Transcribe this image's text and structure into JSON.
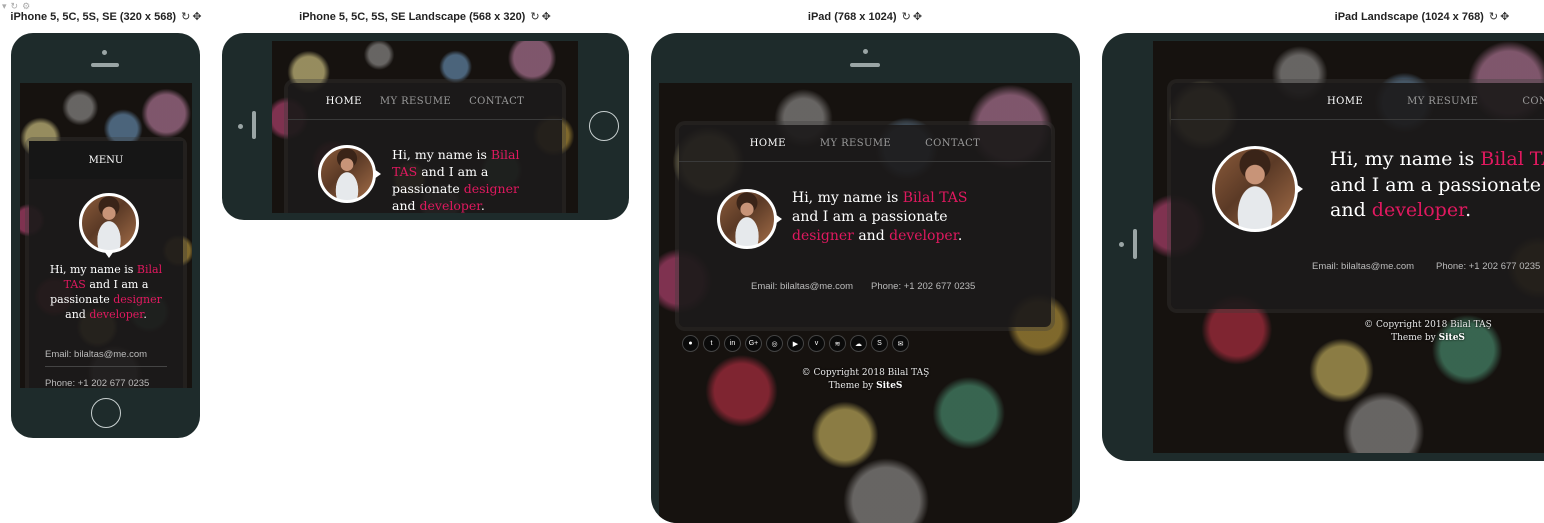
{
  "devices": {
    "iphone": {
      "label": "iPhone 5, 5C, 5S, SE (320 x 568)"
    },
    "iphone_land": {
      "label": "iPhone 5, 5C, 5S, SE Landscape (568 x 320)"
    },
    "ipad": {
      "label": "iPad (768 x 1024)"
    },
    "ipad_land": {
      "label": "iPad Landscape (1024 x 768)"
    }
  },
  "icons": {
    "rotate": "↻",
    "move": "✥"
  },
  "nav": {
    "home": "HOME",
    "resume": "MY RESUME",
    "contact": "CONTACT"
  },
  "menu_label": "MENU",
  "intro": {
    "prefix": "Hi, my name is ",
    "name": "Bilal TAS",
    "name_first": "Bilal",
    "name_last": "TAS",
    "mid": " and I am a passionate ",
    "mid_a": " and I am a",
    "mid_b": "passionate ",
    "mid_c": "and I am a passionate",
    "designer": "designer",
    "and": " and ",
    "developer": "developer",
    "end": "."
  },
  "contact": {
    "email": "Email: bilaltas@me.com",
    "phone": "Phone: +1 202 677 0235"
  },
  "footer": {
    "copyright": "© Copyright 2018 Bilal TAŞ",
    "theme_prefix": "Theme by ",
    "theme_name": "SiteS"
  },
  "social_icons": [
    "github-icon",
    "twitter-icon",
    "linkedin-icon",
    "google-plus-icon",
    "instagram-icon",
    "youtube-icon",
    "vimeo-icon",
    "spotify-icon",
    "soundcloud-icon",
    "skype-icon",
    "email-icon"
  ],
  "social_glyphs": [
    "●",
    "t",
    "in",
    "G+",
    "◎",
    "▶",
    "v",
    "≋",
    "☁",
    "S",
    "✉"
  ]
}
